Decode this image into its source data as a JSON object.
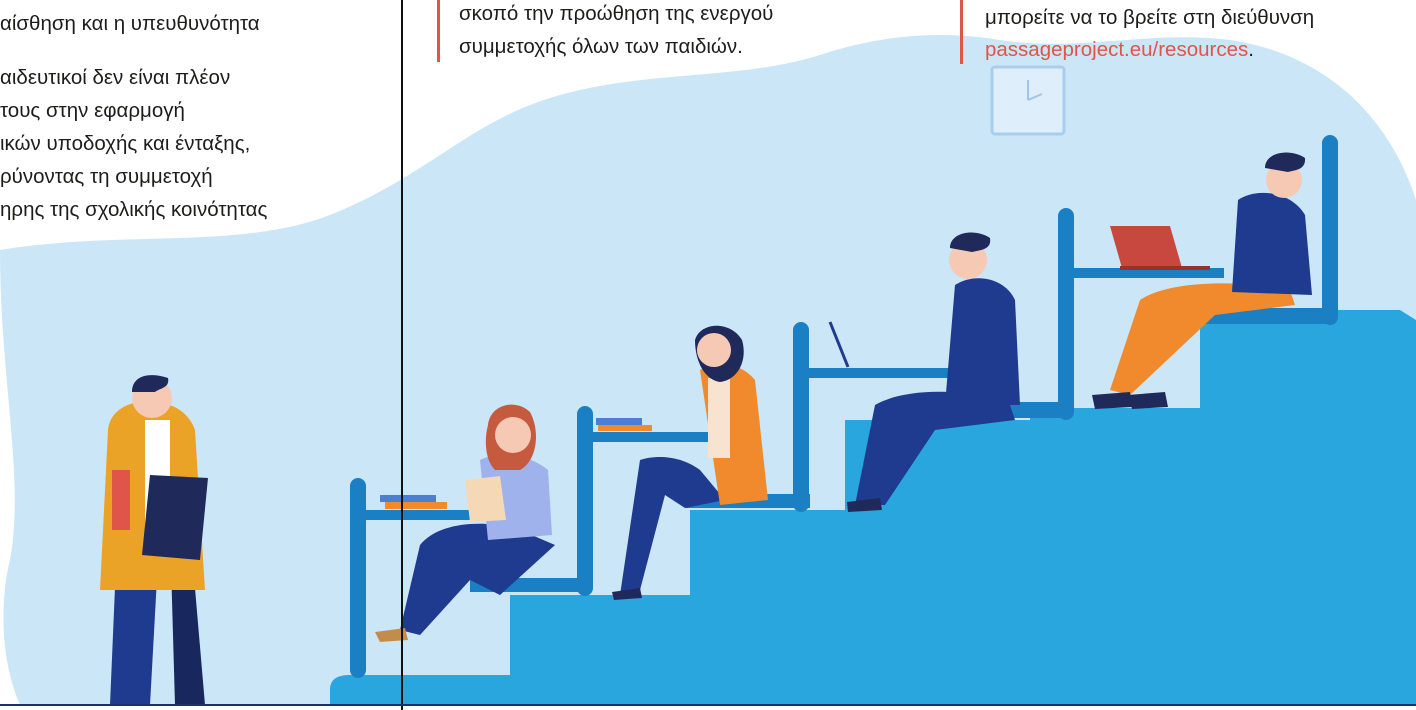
{
  "left_column": {
    "lines": [
      "αίσθηση και η υπευθυνότητα",
      "αιδευτικοί δεν είναι πλέον",
      "τους στην εφαρμογή",
      "ικών υποδοχής και ένταξης,",
      "ρύνοντας τη συμμετοχή",
      "ηρης της σχολικής κοινότητας"
    ]
  },
  "middle_column": {
    "lines": [
      "σκοπό την προώθηση της ενεργού",
      "συμμετοχής όλων των παιδιών."
    ]
  },
  "right_column": {
    "line": "μπορείτε να το βρείτε στη διεύθυνση",
    "link": "passageproject.eu/resources",
    "after_link": "."
  },
  "colors": {
    "accent": "#e0554a",
    "background_blob": "#cbe6f7",
    "stairs": "#2aa6de",
    "stairs_dark": "#1b7fc4",
    "navy": "#1f3b8f",
    "orange": "#f08a2c"
  },
  "illustration": {
    "icons": [
      "wall-clock-icon",
      "laptop-icon",
      "book-stack-icon",
      "clipboard-icon"
    ]
  }
}
